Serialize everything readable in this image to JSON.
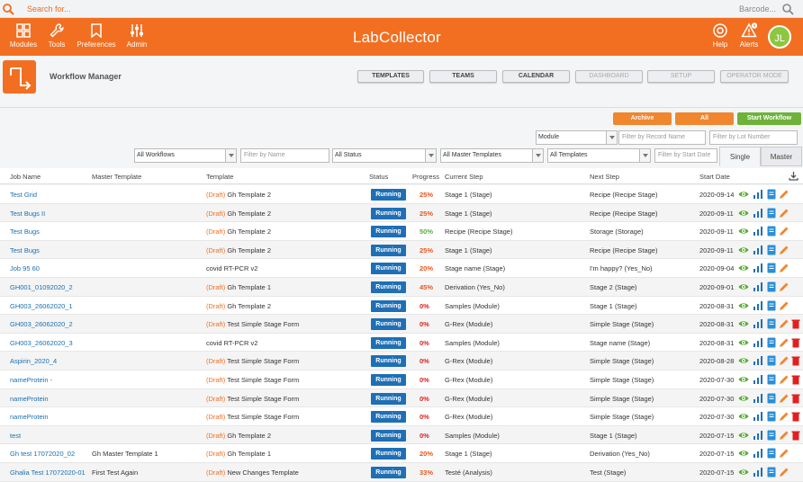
{
  "topbar": {
    "search_placeholder": "Search for...",
    "barcode_placeholder": "Barcode..."
  },
  "nav": {
    "modules": "Modules",
    "tools": "Tools",
    "preferences": "Preferences",
    "admin": "Admin",
    "logo": "LabCollector",
    "help": "Help",
    "alerts": "Alerts",
    "alerts_count": "8",
    "avatar": "JL"
  },
  "page": {
    "title": "Workflow Manager"
  },
  "tabs": [
    "TEMPLATES",
    "TEAMS",
    "CALENDAR",
    "DASHBOARD",
    "SETUP",
    "OPERATOR MODE"
  ],
  "actions": {
    "archive": "Archive",
    "all": "All",
    "start": "Start Workflow"
  },
  "filters": {
    "module": "Module",
    "record_name": "Filter by Record Name",
    "lot_number": "Filter by Lot Number",
    "workflows": "All Workflows",
    "name": "Filter by Name",
    "status": "All Status",
    "master_templates": "All Master Templates",
    "templates": "All Templates",
    "start_date": "Filter by Start Date",
    "single": "Single",
    "master": "Master"
  },
  "columns": [
    "Job Name",
    "Master Template",
    "Template",
    "Status",
    "Progress",
    "Current Step",
    "Next Step",
    "Start Date"
  ],
  "colors": {
    "orange": "#f26f21",
    "green": "#8dc63f",
    "blue": "#1e6fb5",
    "red": "#e02020"
  },
  "rows": [
    {
      "job": "Test Grid",
      "master": "",
      "draft": "(Draft)",
      "template": "Gh Template 2",
      "status": "Running",
      "progress": "25%",
      "pcolor": "#e8561c",
      "step": "Stage 1 (Stage)",
      "next": "Recipe (Recipe Stage)",
      "date": "2020-09-14",
      "del": false
    },
    {
      "job": "Test Bugs II",
      "master": "",
      "draft": "(Draft)",
      "template": "Gh Template 2",
      "status": "Running",
      "progress": "25%",
      "pcolor": "#e8561c",
      "step": "Stage 1 (Stage)",
      "next": "Recipe (Recipe Stage)",
      "date": "2020-09-11",
      "del": false
    },
    {
      "job": "Test Bugs",
      "master": "",
      "draft": "(Draft)",
      "template": "Gh Template 2",
      "status": "Running",
      "progress": "50%",
      "pcolor": "#5aa84a",
      "step": "Recipe (Recipe Stage)",
      "next": "Storage (Storage)",
      "date": "2020-09-11",
      "del": false
    },
    {
      "job": "Test Bugs",
      "master": "",
      "draft": "(Draft)",
      "template": "Gh Template 2",
      "status": "Running",
      "progress": "25%",
      "pcolor": "#e8561c",
      "step": "Stage 1 (Stage)",
      "next": "Recipe (Recipe Stage)",
      "date": "2020-09-11",
      "del": false
    },
    {
      "job": "Job 95 60",
      "master": "",
      "draft": "",
      "template": "covid RT-PCR v2",
      "status": "Running",
      "progress": "20%",
      "pcolor": "#e8561c",
      "step": "Stage name (Stage)",
      "next": "I'm happy? (Yes_No)",
      "date": "2020-09-04",
      "del": false
    },
    {
      "job": "GH001_01092020_2",
      "master": "",
      "draft": "(Draft)",
      "template": "Gh Template 1",
      "status": "Running",
      "progress": "45%",
      "pcolor": "#e8561c",
      "step": "Derivation (Yes_No)",
      "next": "Stage 2 (Stage)",
      "date": "2020-09-01",
      "del": false
    },
    {
      "job": "GH003_26062020_1",
      "master": "",
      "draft": "(Draft)",
      "template": "Gh Template 2",
      "status": "Running",
      "progress": "0%",
      "pcolor": "#e02020",
      "step": "Samples (Module)",
      "next": "Stage 1 (Stage)",
      "date": "2020-08-31",
      "del": false
    },
    {
      "job": "GH003_26062020_2",
      "master": "",
      "draft": "(Draft)",
      "template": "Test Simple Stage Form",
      "status": "Running",
      "progress": "0%",
      "pcolor": "#e02020",
      "step": "G-Rex (Module)",
      "next": "Simple Stage (Stage)",
      "date": "2020-08-31",
      "del": true
    },
    {
      "job": "GH003_26062020_3",
      "master": "",
      "draft": "",
      "template": "covid RT-PCR v2",
      "status": "Running",
      "progress": "0%",
      "pcolor": "#e02020",
      "step": "Samples (Module)",
      "next": "Stage name (Stage)",
      "date": "2020-08-31",
      "del": true
    },
    {
      "job": "Aspirin_2020_4",
      "master": "",
      "draft": "(Draft)",
      "template": "Test Simple Stage Form",
      "status": "Running",
      "progress": "0%",
      "pcolor": "#e02020",
      "step": "G-Rex (Module)",
      "next": "Simple Stage (Stage)",
      "date": "2020-08-28",
      "del": true
    },
    {
      "job": "nameProtein -",
      "master": "",
      "draft": "(Draft)",
      "template": "Test Simple Stage Form",
      "status": "Running",
      "progress": "0%",
      "pcolor": "#e02020",
      "step": "G-Rex (Module)",
      "next": "Simple Stage (Stage)",
      "date": "2020-07-30",
      "del": true
    },
    {
      "job": "nameProtein",
      "master": "",
      "draft": "(Draft)",
      "template": "Test Simple Stage Form",
      "status": "Running",
      "progress": "0%",
      "pcolor": "#e02020",
      "step": "G-Rex (Module)",
      "next": "Simple Stage (Stage)",
      "date": "2020-07-30",
      "del": true
    },
    {
      "job": "nameProtein",
      "master": "",
      "draft": "(Draft)",
      "template": "Test Simple Stage Form",
      "status": "Running",
      "progress": "0%",
      "pcolor": "#e02020",
      "step": "G-Rex (Module)",
      "next": "Simple Stage (Stage)",
      "date": "2020-07-30",
      "del": true
    },
    {
      "job": "test",
      "master": "",
      "draft": "(Draft)",
      "template": "Gh Template 2",
      "status": "Running",
      "progress": "0%",
      "pcolor": "#e02020",
      "step": "Samples (Module)",
      "next": "Stage 1 (Stage)",
      "date": "2020-07-15",
      "del": true
    },
    {
      "job": "Gh test 17072020_02",
      "master": "Gh Master Template 1",
      "draft": "(Draft)",
      "template": "Gh Template 1",
      "status": "Running",
      "progress": "20%",
      "pcolor": "#e8561c",
      "step": "Stage 1 (Stage)",
      "next": "Derivation (Yes_No)",
      "date": "2020-07-15",
      "del": false
    },
    {
      "job": "Ghalia Test 17072020-01",
      "master": "First Test Again",
      "draft": "(Draft)",
      "template": "New Changes Template",
      "status": "Running",
      "progress": "33%",
      "pcolor": "#e8561c",
      "step": "Testé (Analysis)",
      "next": "Test (Stage)",
      "date": "2020-07-15",
      "del": false
    }
  ]
}
